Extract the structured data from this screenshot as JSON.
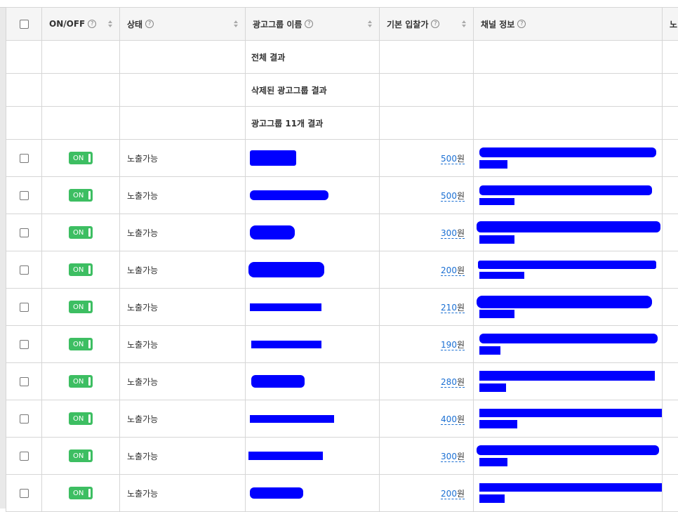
{
  "headers": {
    "onoff": "ON/OFF",
    "status": "상태",
    "name": "광고그룹 이름",
    "bid": "기본 입찰가",
    "channel": "채널 정보",
    "extra": "노"
  },
  "summary_rows": [
    "전체 결과",
    "삭제된 광고그룹 결과",
    "광고그룹 11개 결과"
  ],
  "toggle_label": "ON",
  "rows": [
    {
      "status": "노출가능",
      "bid": "500",
      "unit": "원"
    },
    {
      "status": "노출가능",
      "bid": "500",
      "unit": "원"
    },
    {
      "status": "노출가능",
      "bid": "300",
      "unit": "원"
    },
    {
      "status": "노출가능",
      "bid": "200",
      "unit": "원"
    },
    {
      "status": "노출가능",
      "bid": "210",
      "unit": "원"
    },
    {
      "status": "노출가능",
      "bid": "190",
      "unit": "원"
    },
    {
      "status": "노출가능",
      "bid": "280",
      "unit": "원"
    },
    {
      "status": "노출가능",
      "bid": "400",
      "unit": "원"
    },
    {
      "status": "노출가능",
      "bid": "300",
      "unit": "원"
    },
    {
      "status": "노출가능",
      "bid": "200",
      "unit": "원"
    }
  ],
  "colors": {
    "toggle_on": "#3dbe62",
    "link": "#1a6fd3",
    "redaction": "#0000ff"
  }
}
